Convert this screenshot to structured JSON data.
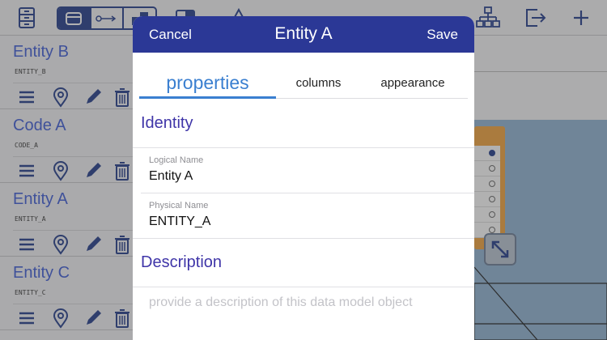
{
  "sidebar": {
    "entities": [
      {
        "name": "Entity B",
        "physical": "ENTITY_B"
      },
      {
        "name": "Code A",
        "physical": "CODE_A"
      },
      {
        "name": "Entity A",
        "physical": "ENTITY_A"
      },
      {
        "name": "Entity C",
        "physical": "ENTITY_C"
      }
    ]
  },
  "colors": {
    "header": "#2b3896",
    "accent_blue": "#3a7fd0",
    "section_purple": "#3f35a8",
    "entity_orange": "#f3a23a"
  },
  "modal": {
    "cancel_label": "Cancel",
    "title": "Entity A",
    "save_label": "Save",
    "tabs": [
      {
        "label": "properties",
        "active": true
      },
      {
        "label": "columns",
        "active": false
      },
      {
        "label": "appearance",
        "active": false
      }
    ],
    "identity": {
      "heading": "Identity",
      "logical_label": "Logical Name",
      "logical_value": "Entity A",
      "physical_label": "Physical Name",
      "physical_value": "ENTITY_A"
    },
    "description": {
      "heading": "Description",
      "placeholder": "provide a description of this data model object"
    }
  }
}
